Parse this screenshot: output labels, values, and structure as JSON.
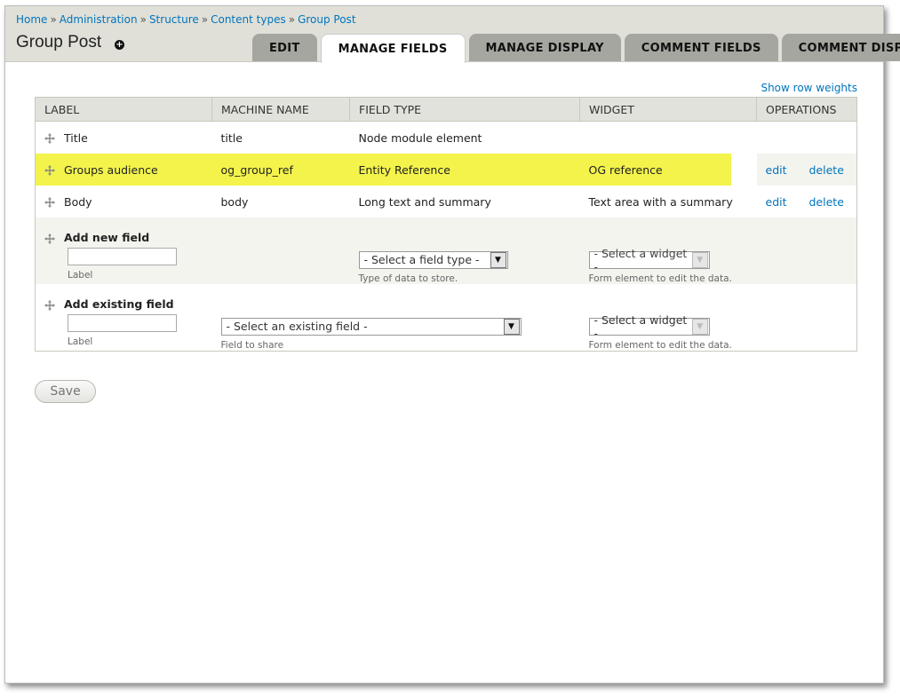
{
  "breadcrumb": [
    {
      "label": "Home"
    },
    {
      "label": "Administration"
    },
    {
      "label": "Structure"
    },
    {
      "label": "Content types"
    },
    {
      "label": "Group Post"
    }
  ],
  "page_title": "Group Post",
  "tabs": [
    {
      "label": "EDIT"
    },
    {
      "label": "MANAGE FIELDS"
    },
    {
      "label": "MANAGE DISPLAY"
    },
    {
      "label": "COMMENT FIELDS"
    },
    {
      "label": "COMMENT DISPLAY"
    }
  ],
  "show_row_weights": "Show row weights",
  "table": {
    "headers": [
      "LABEL",
      "MACHINE NAME",
      "FIELD TYPE",
      "WIDGET",
      "OPERATIONS"
    ],
    "rows": [
      {
        "label": "Title",
        "machine": "title",
        "type": "Node module element",
        "widget": "",
        "edit": "",
        "delete": ""
      },
      {
        "label": "Groups audience",
        "machine": "og_group_ref",
        "type": "Entity Reference",
        "widget": "OG reference",
        "edit": "edit",
        "delete": "delete"
      },
      {
        "label": "Body",
        "machine": "body",
        "type": "Long text and summary",
        "widget": "Text area with a summary",
        "edit": "edit",
        "delete": "delete"
      }
    ],
    "add_new": {
      "title": "Add new field",
      "label_desc": "Label",
      "type_select": "- Select a field type -",
      "type_desc": "Type of data to store.",
      "widget_select": "- Select a widget -",
      "widget_desc": "Form element to edit the data."
    },
    "add_existing": {
      "title": "Add existing field",
      "label_desc": "Label",
      "field_select": "- Select an existing field -",
      "field_desc": "Field to share",
      "widget_select": "- Select a widget -",
      "widget_desc": "Form element to edit the data."
    }
  },
  "save_label": "Save",
  "colors": {
    "link": "#0074bd",
    "highlight": "#f2f23d",
    "header_bg": "#e0e0d8",
    "tab_bg": "#a6a6a0"
  }
}
